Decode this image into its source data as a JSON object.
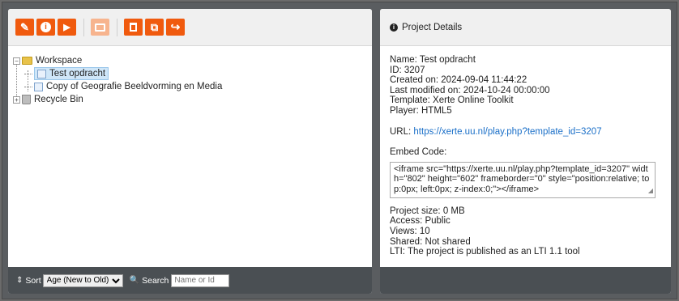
{
  "toolbar": {
    "buttons": [
      {
        "icon": "edit-icon",
        "glyph": "✎"
      },
      {
        "icon": "info-icon",
        "glyph": "i"
      },
      {
        "icon": "play-icon",
        "glyph": "▶"
      },
      {
        "icon": "folder-icon",
        "glyph": ""
      },
      {
        "icon": "delete-icon",
        "glyph": "🗑"
      },
      {
        "icon": "duplicate-icon",
        "glyph": "⧉"
      },
      {
        "icon": "share-icon",
        "glyph": "↪"
      }
    ]
  },
  "tree": {
    "root_label": "Workspace",
    "items": [
      "Test opdracht",
      "Copy of Geografie Beeldvorming en Media"
    ],
    "recycle_label": "Recycle Bin"
  },
  "footer": {
    "sort_label": "Sort",
    "sort_value": "Age (New to Old)",
    "search_label": "Search",
    "search_placeholder": "Name or Id"
  },
  "details": {
    "title": "Project Details",
    "name": "Name: Test opdracht",
    "id": "ID: 3207",
    "created": "Created on: 2024-09-04 11:44:22",
    "modified": "Last modified on: 2024-10-24 00:00:00",
    "template": "Template: Xerte Online Toolkit",
    "player": "Player: HTML5",
    "url_prefix": "URL: ",
    "url": "https://xerte.uu.nl/play.php?template_id=3207",
    "embed_label": "Embed Code:",
    "embed_code": "<iframe src=\"https://xerte.uu.nl/play.php?template_id=3207\" width=\"802\" height=\"602\" frameborder=\"0\" style=\"position:relative; top:0px; left:0px; z-index:0;\"></iframe>",
    "size": "Project size: 0 MB",
    "access": "Access: Public",
    "views": "Views: 10",
    "shared": "Shared: Not shared",
    "lti": "LTI: The project is published as an LTI 1.1 tool"
  },
  "colors": {
    "accent": "#f05a0e",
    "footer_bg": "#4a4f53",
    "link": "#1a6fc8"
  }
}
